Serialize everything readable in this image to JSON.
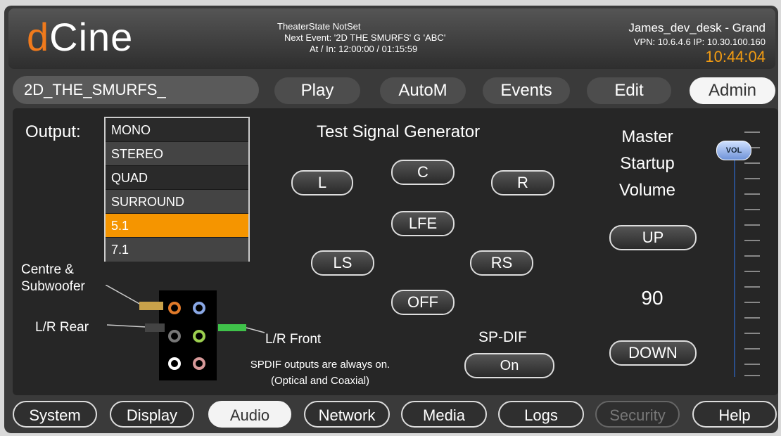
{
  "header": {
    "logo_d": "d",
    "logo_rest": "Cine",
    "theater_state": "TheaterState  NotSet",
    "next_event": "Next Event:  '2D THE SMURFS' G 'ABC'",
    "at_in": "At / In:  12:00:00 / 01:15:59",
    "host": "James_dev_desk - Grand",
    "network": "VPN: 10.6.4.6   IP: 10.30.100.160",
    "clock": "10:44:04"
  },
  "nav": {
    "playlist_name": "2D_THE_SMURFS_",
    "play": "Play",
    "autom": "AutoM",
    "events": "Events",
    "edit": "Edit",
    "admin": "Admin"
  },
  "audio": {
    "output_label": "Output:",
    "output_options": [
      "MONO",
      "STEREO",
      "QUAD",
      "SURROUND",
      "5.1",
      "7.1"
    ],
    "selected_output": "5.1",
    "centre_sub": "Centre &",
    "centre_sub2": "Subwoofer",
    "lr_rear": "L/R Rear",
    "lr_front": "L/R Front",
    "spdif_note1": "SPDIF outputs are always on.",
    "spdif_note2": "(Optical and Coaxial)",
    "test_signal_title": "Test Signal Generator",
    "buttons": {
      "l": "L",
      "c": "C",
      "r": "R",
      "lfe": "LFE",
      "ls": "LS",
      "rs": "RS",
      "off": "OFF"
    },
    "spdif_label": "SP-DIF",
    "spdif_value": "On",
    "master_line1": "Master",
    "master_line2": "Startup",
    "master_line3": "Volume",
    "up": "UP",
    "volume": "90",
    "down": "DOWN",
    "vol_knob": "VOL"
  },
  "tabs": {
    "system": "System",
    "display": "Display",
    "audio": "Audio",
    "network": "Network",
    "media": "Media",
    "logs": "Logs",
    "security": "Security",
    "help": "Help"
  },
  "colors": {
    "accent": "#f59500",
    "logo_orange": "#f07a1c",
    "clock": "#f39c12"
  }
}
